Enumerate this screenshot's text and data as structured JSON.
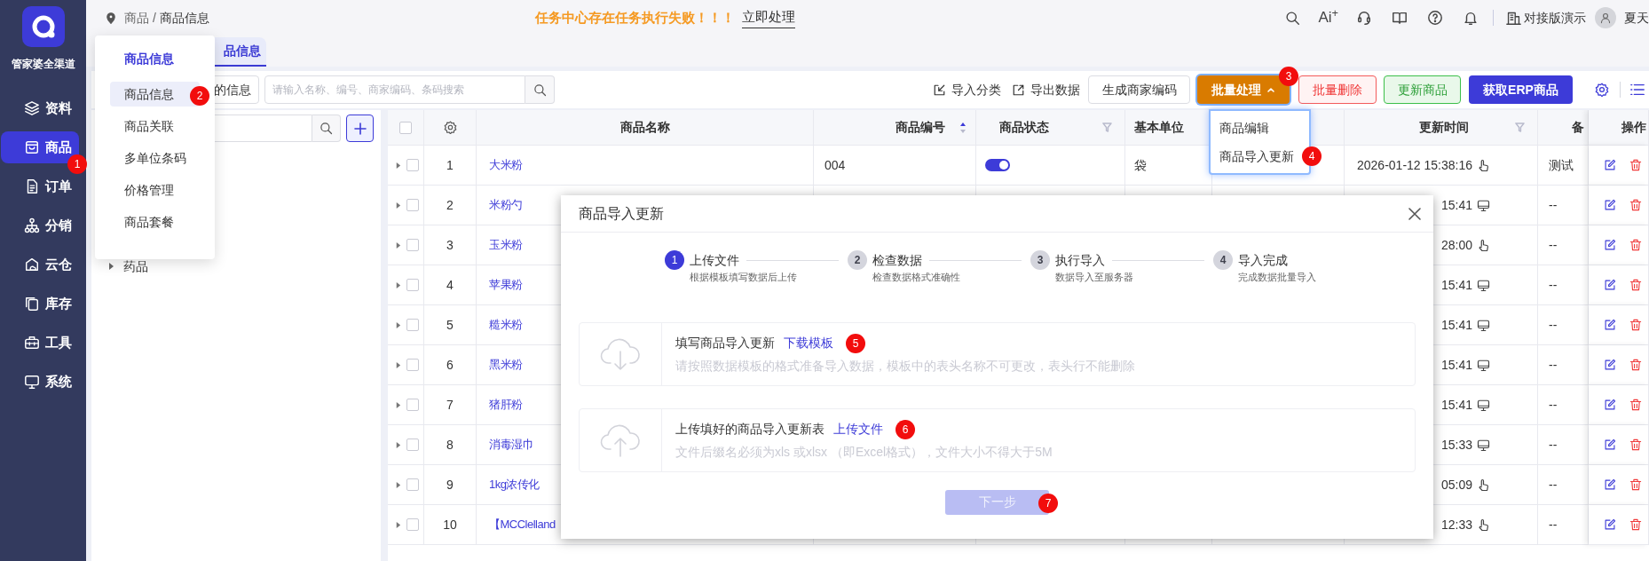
{
  "sidebar": {
    "brand": "管家婆全渠道",
    "items": [
      {
        "label": "资料",
        "selected": false
      },
      {
        "label": "商品",
        "selected": true,
        "badge": "1"
      },
      {
        "label": "订单",
        "selected": false
      },
      {
        "label": "分销",
        "selected": false
      },
      {
        "label": "云仓",
        "selected": false
      },
      {
        "label": "库存",
        "selected": false
      },
      {
        "label": "工具",
        "selected": false
      },
      {
        "label": "系统",
        "selected": false
      }
    ]
  },
  "header": {
    "breadcrumb": [
      "商品",
      "商品信息"
    ],
    "breadcrumb_separator": "/",
    "alert": "任务中心存在任务执行失败！！！",
    "alert_action": "立即处理",
    "ai_label": "Ai$^{+}$",
    "account": "对接版演示",
    "user": "夏天"
  },
  "tabs": [
    {
      "label": "品信息",
      "selected": true
    }
  ],
  "menu": {
    "title": "商品信息",
    "items": [
      {
        "label": "商品信息",
        "selected": true,
        "badge": "2"
      },
      {
        "label": "商品关联",
        "selected": false
      },
      {
        "label": "多单位条码",
        "selected": false
      },
      {
        "label": "价格管理",
        "selected": false
      },
      {
        "label": "商品套餐",
        "selected": false
      }
    ]
  },
  "toolbar": {
    "filter_button": "的信息",
    "search_placeholder": "请输入名称、编号、商家编码、条码搜索",
    "actions": [
      {
        "label": "导入分类",
        "kind": "link"
      },
      {
        "label": "导出数据",
        "kind": "link"
      },
      {
        "label": "生成商家编码",
        "kind": "default"
      },
      {
        "label": "批量处理",
        "kind": "warning",
        "expanded": true,
        "badge": "3"
      },
      {
        "label": "批量删除",
        "kind": "danger"
      },
      {
        "label": "更新商品",
        "kind": "success"
      },
      {
        "label": "获取ERP商品",
        "kind": "primary"
      }
    ]
  },
  "batch_menu": {
    "items": [
      {
        "label": "商品编辑"
      },
      {
        "label": "商品导入更新",
        "badge": "4"
      }
    ]
  },
  "tree": {
    "items": [
      {
        "label": "药品",
        "expanded": false
      }
    ]
  },
  "table": {
    "select_all_checked": false,
    "columns": [
      {
        "label": "商品名称",
        "kind": "plain"
      },
      {
        "label": "商品编号",
        "kind": "sortable"
      },
      {
        "label": "商品状态",
        "kind": "filterable"
      },
      {
        "label": "基本单位",
        "kind": "plain"
      },
      {
        "label": "更新时间",
        "kind": "filterable"
      },
      {
        "label": "备",
        "kind": "plain"
      },
      {
        "label": "操作",
        "kind": "plain"
      }
    ],
    "rows": [
      {
        "index": "1",
        "expanded": false,
        "checked": false,
        "name": "大米粉",
        "code": "004",
        "enabled": true,
        "unit": "袋",
        "updated": "2026-01-12 15:38:16",
        "kind": "touch",
        "remark": "测试"
      },
      {
        "index": "2",
        "expanded": false,
        "checked": false,
        "name": "米粉勺",
        "updated": "15:41",
        "kind": "desktop",
        "remark": "--"
      },
      {
        "index": "3",
        "expanded": false,
        "checked": false,
        "name": "玉米粉",
        "updated": "28:00",
        "kind": "touch",
        "remark": "--"
      },
      {
        "index": "4",
        "expanded": false,
        "checked": false,
        "name": "苹果粉",
        "updated": "15:41",
        "kind": "desktop",
        "remark": "--"
      },
      {
        "index": "5",
        "expanded": false,
        "checked": false,
        "name": "糙米粉",
        "updated": "15:41",
        "kind": "desktop",
        "remark": "--"
      },
      {
        "index": "6",
        "expanded": false,
        "checked": false,
        "name": "黑米粉",
        "updated": "15:41",
        "kind": "desktop",
        "remark": "--"
      },
      {
        "index": "7",
        "expanded": false,
        "checked": false,
        "name": "猪肝粉",
        "updated": "15:41",
        "kind": "desktop",
        "remark": "--"
      },
      {
        "index": "8",
        "expanded": false,
        "checked": false,
        "name": "消毒湿巾",
        "updated": "15:33",
        "kind": "desktop",
        "remark": "--"
      },
      {
        "index": "9",
        "expanded": false,
        "checked": false,
        "name": "1kg浓传化",
        "updated": "05:09",
        "kind": "touch",
        "remark": "--"
      },
      {
        "index": "10",
        "expanded": false,
        "checked": false,
        "name": "【MCClelland",
        "updated": "12:33",
        "kind": "touch",
        "remark": "--"
      }
    ]
  },
  "dialog": {
    "title": "商品导入更新",
    "steps": [
      {
        "number": "1",
        "title": "上传文件",
        "subtitle": "根据模板填写数据后上传",
        "selected": true
      },
      {
        "number": "2",
        "title": "检查数据",
        "subtitle": "检查数据格式准确性",
        "selected": false
      },
      {
        "number": "3",
        "title": "执行导入",
        "subtitle": "数据导入至服务器",
        "selected": false
      },
      {
        "number": "4",
        "title": "导入完成",
        "subtitle": "完成数据批量导入",
        "selected": false
      }
    ],
    "sections": [
      {
        "kind": "download",
        "title": "填写商品导入更新",
        "link": "下载模板",
        "badge": "5",
        "hint": "请按照数据模板的格式准备导入数据，模板中的表头名称不可更改，表头行不能删除"
      },
      {
        "kind": "upload",
        "title": "上传填好的商品导入更新表",
        "link": "上传文件",
        "badge": "6",
        "hint": "文件后缀名必须为xls 或xlsx （即Excel格式），文件大小不得大于5M"
      }
    ],
    "next_button": {
      "label": "下一步",
      "disabled": true,
      "badge": "7"
    }
  }
}
